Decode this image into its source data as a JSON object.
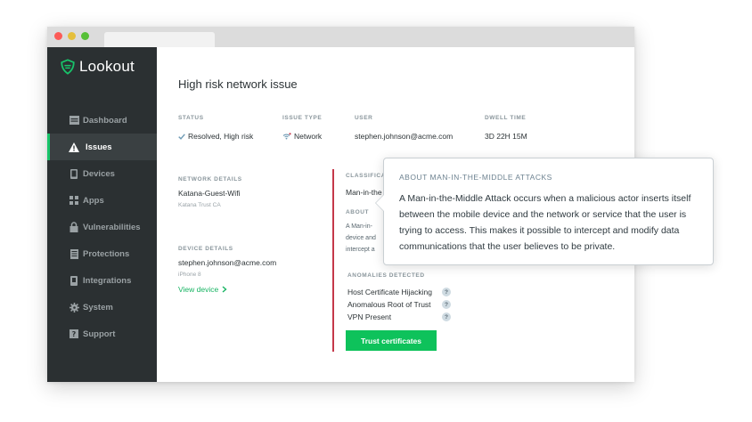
{
  "sidebar": {
    "brand": "Lookout",
    "items": [
      {
        "label": "Dashboard",
        "icon": "dashboard-icon"
      },
      {
        "label": "Issues",
        "icon": "warning-icon",
        "active": true
      },
      {
        "label": "Devices",
        "icon": "phone-icon"
      },
      {
        "label": "Apps",
        "icon": "apps-grid-icon"
      },
      {
        "label": "Vulnerabilities",
        "icon": "lock-icon"
      },
      {
        "label": "Protections",
        "icon": "document-icon"
      },
      {
        "label": "Integrations",
        "icon": "plug-icon"
      },
      {
        "label": "System",
        "icon": "gear-icon"
      },
      {
        "label": "Support",
        "icon": "question-icon"
      }
    ]
  },
  "issue": {
    "title": "High risk network issue",
    "status_label": "STATUS",
    "status_value": "Resolved, High risk",
    "type_label": "ISSUE TYPE",
    "type_value": "Network",
    "user_label": "USER",
    "user_value": "stephen.johnson@acme.com",
    "dwell_label": "DWELL TIME",
    "dwell_value": "3D 22H 15M"
  },
  "network": {
    "label": "NETWORK DETAILS",
    "name": "Katana-Guest-Wifi",
    "ca": "Katana Trust CA"
  },
  "device": {
    "label": "DEVICE DETAILS",
    "email": "stephen.johnson@acme.com",
    "model": "iPhone 8",
    "link": "View device"
  },
  "classification": {
    "label": "CLASSIFICA",
    "value": "Man-in-the",
    "about_label": "ABOUT",
    "about_lines": [
      "A Man-in-",
      "device and",
      "intercept a"
    ]
  },
  "anomalies": {
    "label": "ANOMALIES DETECTED",
    "items": [
      "Host Certificate Hijacking",
      "Anomalous Root of Trust",
      "VPN Present"
    ],
    "badge": "?"
  },
  "actions": {
    "trust_label": "Trust certificates"
  },
  "tooltip": {
    "title": "ABOUT MAN-IN-THE-MIDDLE ATTACKS",
    "body": "A Man-in-the-Middle Attack occurs when a malicious actor inserts itself between the mobile device and the network or service that the user is trying to access. This makes it possible to intercept and modify data communications that the user believes to be private."
  },
  "colors": {
    "accent": "#18c46a",
    "sidebar_bg": "#2b3032",
    "risk": "#c5384a",
    "button": "#0ec25b"
  }
}
